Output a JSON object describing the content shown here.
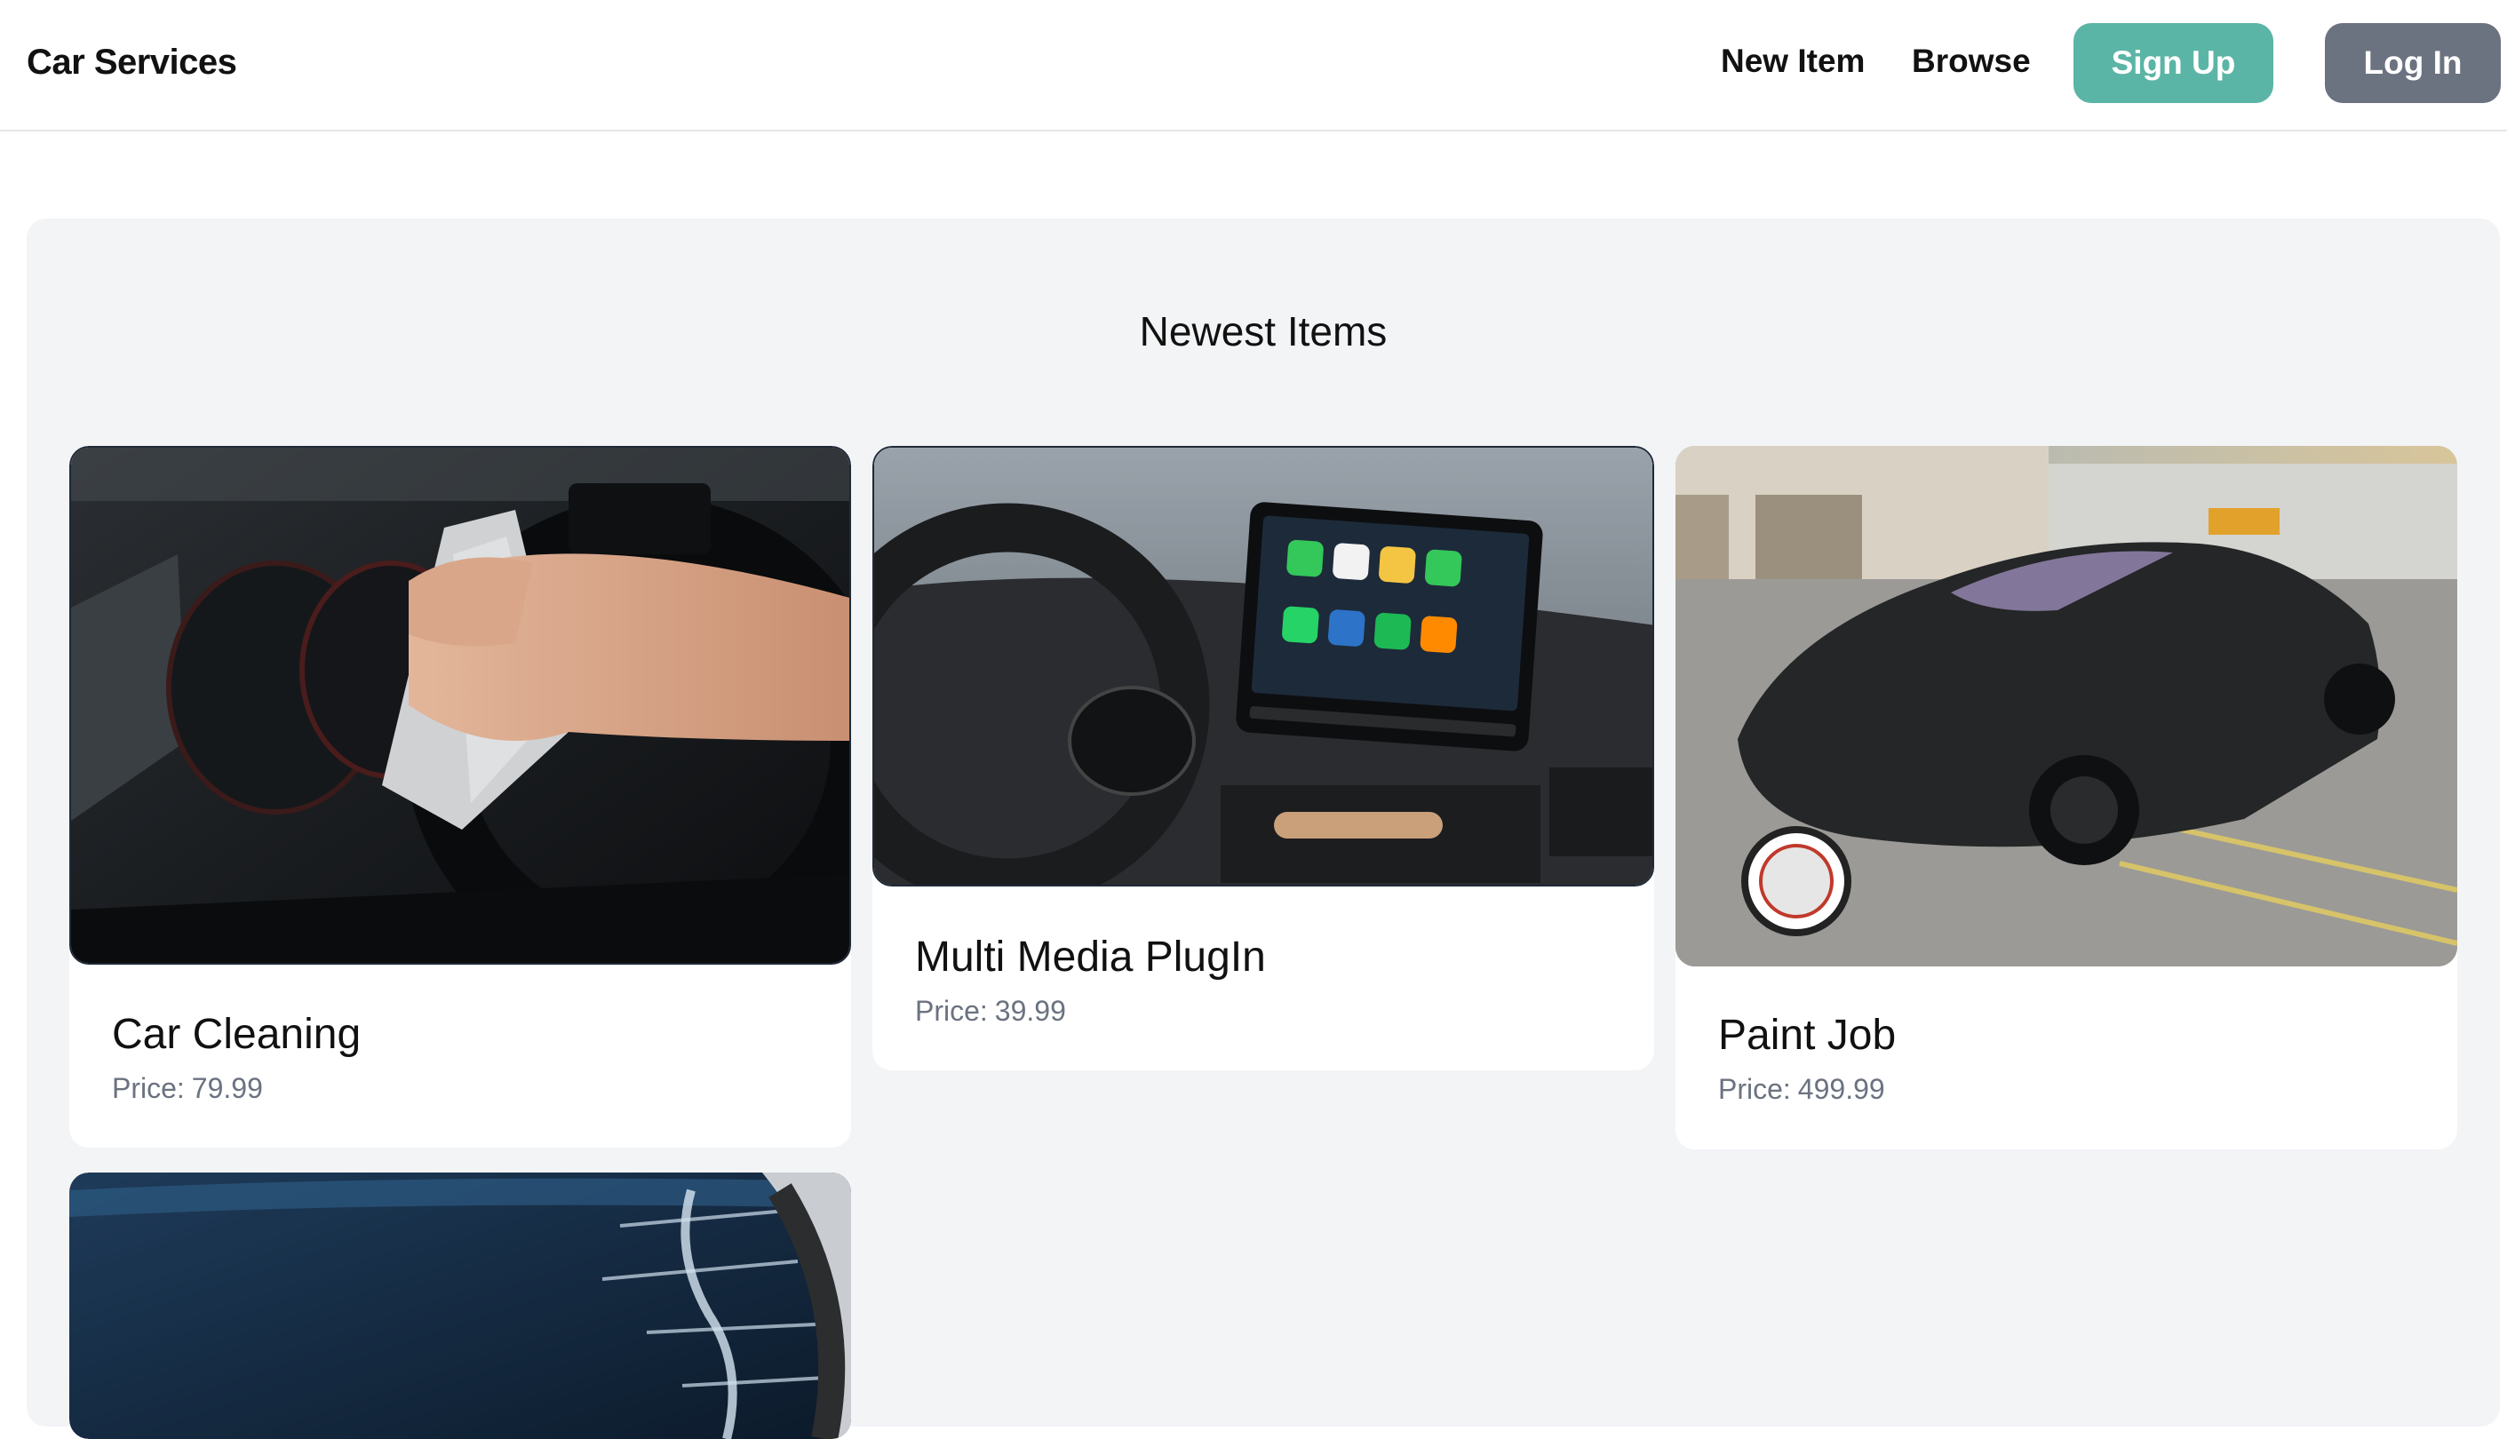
{
  "header": {
    "brand": "Car Services",
    "nav": {
      "new_item": "New Item",
      "browse": "Browse"
    },
    "sign_up": "Sign Up",
    "log_in": "Log In"
  },
  "main": {
    "section_title": "Newest Items",
    "price_label": "Price:",
    "items": [
      {
        "title": "Car Cleaning",
        "price": "79.99"
      },
      {
        "title": "Multi Media PlugIn",
        "price": "39.99"
      },
      {
        "title": "Paint Job",
        "price": "499.99"
      },
      {
        "title": "",
        "price": ""
      }
    ]
  },
  "colors": {
    "sign_up_bg": "#5bb5a6",
    "log_in_bg": "#6b7280",
    "panel_bg": "#f3f4f6"
  }
}
